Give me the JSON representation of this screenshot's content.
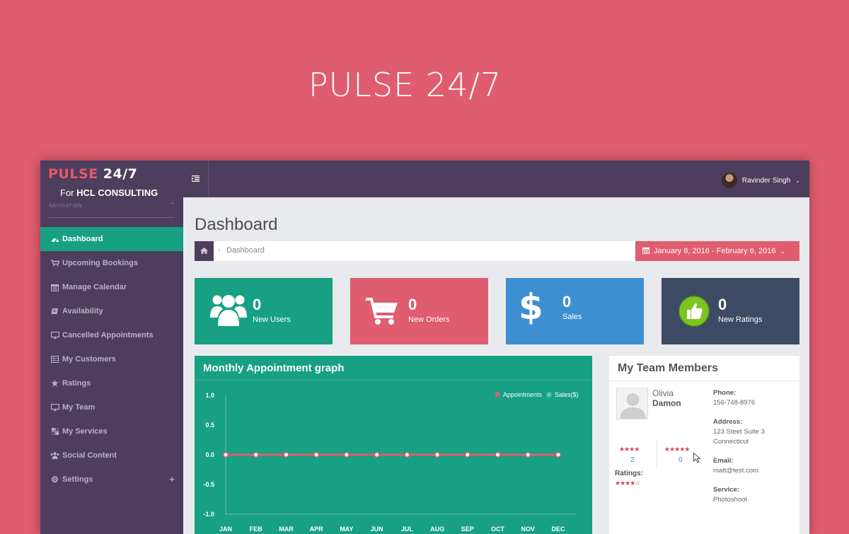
{
  "hero": {
    "title": "PULSE 24/7"
  },
  "sidebar": {
    "brand_part1": "PULSE",
    "brand_part2": "24/7",
    "subtitle_prefix": "For",
    "subtitle_company": "HCL CONSULTING",
    "nav_label": "NAVIGATION",
    "items": [
      {
        "label": "Dashboard",
        "icon": "dashboard-icon",
        "active": true
      },
      {
        "label": "Upcoming Bookings",
        "icon": "cart-icon"
      },
      {
        "label": "Manage Calendar",
        "icon": "calendar-icon"
      },
      {
        "label": "Availability",
        "icon": "book-icon"
      },
      {
        "label": "Cancelled Appointments",
        "icon": "monitor-icon"
      },
      {
        "label": "My Customers",
        "icon": "table-icon"
      },
      {
        "label": "Ratings",
        "icon": "star-icon"
      },
      {
        "label": "My Team",
        "icon": "monitor-icon"
      },
      {
        "label": "My Services",
        "icon": "grid-icon"
      },
      {
        "label": "Social Content",
        "icon": "users-icon"
      },
      {
        "label": "Settings",
        "icon": "gear-icon",
        "expand": "+"
      }
    ]
  },
  "topbar": {
    "user_name": "Ravinder Singh"
  },
  "main": {
    "page_title": "Dashboard",
    "breadcrumb_current": "Dashboard",
    "date_range": "January 8, 2016 - February 6, 2016"
  },
  "stats": [
    {
      "value": "0",
      "label": "New Users",
      "color": "#17a083",
      "icon": "users-icon"
    },
    {
      "value": "0",
      "label": "New Orders",
      "color": "#e05c6f",
      "icon": "cart-icon"
    },
    {
      "value": "0",
      "label": "Sales",
      "color": "#3e8fd2",
      "icon": "dollar-icon"
    },
    {
      "value": "0",
      "label": "New Ratings",
      "color": "#3d4a63",
      "icon": "thumbs-up-icon"
    }
  ],
  "chart": {
    "title": "Monthly Appointment graph"
  },
  "chart_data": {
    "type": "line",
    "categories": [
      "JAN",
      "FEB",
      "MAR",
      "APR",
      "MAY",
      "JUN",
      "JUL",
      "AUG",
      "SEP",
      "OCT",
      "NOV",
      "DEC"
    ],
    "series": [
      {
        "name": "Appointments",
        "color": "#e05c6f",
        "values": [
          0,
          0,
          0,
          0,
          0,
          0,
          0,
          0,
          0,
          0,
          0,
          0
        ]
      },
      {
        "name": "Sales($)",
        "color": "#5fc9a8",
        "values": [
          0,
          0,
          0,
          0,
          0,
          0,
          0,
          0,
          0,
          0,
          0,
          0
        ]
      }
    ],
    "yticks": [
      "1.0",
      "0.5",
      "0.0",
      "-0.5",
      "-1.0"
    ],
    "ylim": [
      -1,
      1
    ],
    "legend": "top-right"
  },
  "team": {
    "title": "My Team Members",
    "member": {
      "first_name": "Olivia",
      "last_name": "Damon",
      "stars_a": "★★★★",
      "count_a": "2",
      "stars_b": "★★★★★",
      "count_b": "0",
      "ratings_label": "Ratings:",
      "ratings_stars": "★★★★☆",
      "rating_value": 4,
      "phone_label": "Phone:",
      "phone": "156-748-8976",
      "address_label": "Address:",
      "address_line1": "123 Steet Suite 3",
      "address_line2": "Connecticut",
      "email_label": "Email:",
      "email": "matt@test.com",
      "service_label": "Service:",
      "service": "Photoshoot"
    }
  }
}
